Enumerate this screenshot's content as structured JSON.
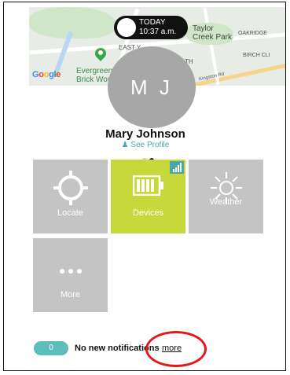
{
  "map": {
    "labels": {
      "taylor": "Taylor",
      "creek_park": "Creek Park",
      "oakridge": "OAKRIDGE",
      "birch_cliff": "BIRCH CLI",
      "east_y": "EAST Y",
      "evergreen": "Evergreen",
      "brick_works": "Brick Work",
      "kingston": "Kingston Rd",
      "th": "TH"
    },
    "google": [
      "G",
      "o",
      "o",
      "g",
      "l",
      "e"
    ]
  },
  "time": {
    "line1": "TODAY",
    "line2": "10:37 a.m."
  },
  "profile": {
    "initials": "M J",
    "name": "Mary Johnson",
    "see_profile": "See Profile"
  },
  "pager": {
    "count": 2,
    "active_index": 1
  },
  "tiles": [
    {
      "label": "Locate",
      "icon": "crosshair-icon"
    },
    {
      "label": "Devices",
      "icon": "battery-icon"
    },
    {
      "label": "Weather",
      "icon": "sun-icon"
    },
    {
      "label": "More",
      "icon": "more-dots-icon"
    }
  ],
  "footer": {
    "count": "0",
    "notifications": "No new notifications",
    "more": "more"
  },
  "colors": {
    "accent": "#48a9a6",
    "tile_gray": "#c4c4c4",
    "tile_green": "#c6d83a",
    "highlight": "#e01a1a"
  }
}
